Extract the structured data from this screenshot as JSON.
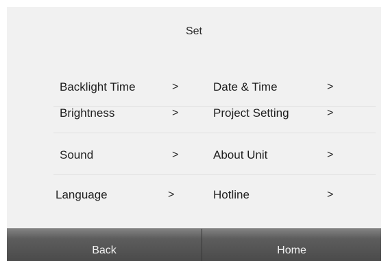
{
  "header": {
    "title": "Set"
  },
  "menu": {
    "chevron": ">",
    "rows": [
      {
        "left": {
          "label": "Backlight Time"
        },
        "right": {
          "label": "Date & Time"
        }
      },
      {
        "left": {
          "label": "Brightness"
        },
        "right": {
          "label": "Project Setting"
        }
      },
      {
        "left": {
          "label": "Sound"
        },
        "right": {
          "label": "About Unit"
        }
      },
      {
        "left": {
          "label": "Language"
        },
        "right": {
          "label": "Hotline"
        }
      }
    ]
  },
  "footer": {
    "back_label": "Back",
    "home_label": "Home"
  },
  "colors": {
    "background": "#f1f1f1",
    "bar": "#4a4a4a",
    "text": "#1e1e1e",
    "bar_text": "#f2f2f2"
  }
}
